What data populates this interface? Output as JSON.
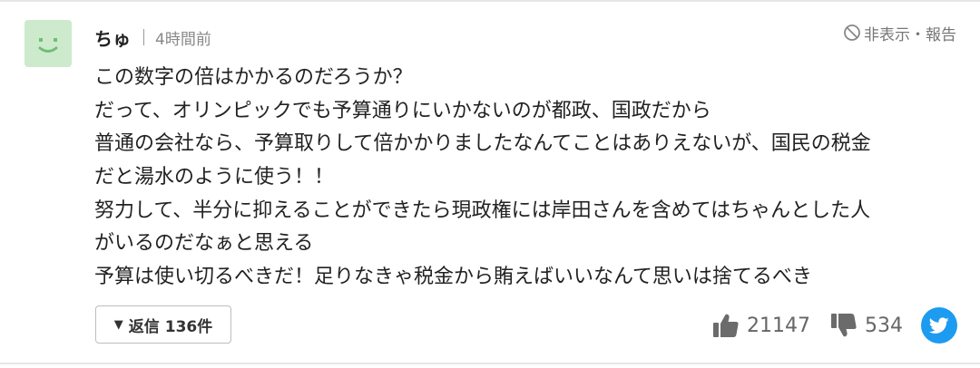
{
  "comment": {
    "username": "ちゅ",
    "timestamp": "4時間前",
    "hide_report_label": "非表示・報告",
    "body_lines": [
      "この数字の倍はかかるのだろうか？",
      "だって、オリンピックでも予算通りにいかないのが都政、国政だから",
      "普通の会社なら、予算取りして倍かかりましたなんてことはありえないが、国民の税金",
      "だと湯水のように使う！！",
      "努力して、半分に抑えることができたら現政権には岸田さんを含めてはちゃんとした人",
      "がいるのだなぁと思える",
      "予算は使い切るべきだ！足りなきゃ税金から賄えばいいなんて思いは捨てるべき"
    ],
    "reply_button": {
      "prefix": "返信",
      "count": "136件"
    },
    "likes": "21147",
    "dislikes": "534"
  },
  "icons": {
    "avatar": "smiley-avatar-icon",
    "hide": "prohibit-icon",
    "like": "thumbs-up-icon",
    "dislike": "thumbs-down-icon",
    "share": "twitter-bird-icon"
  },
  "colors": {
    "avatar_bg": "#cdeacc",
    "avatar_face": "#6fbf73",
    "twitter_blue": "#1d9bf0",
    "muted_text": "#888888"
  }
}
